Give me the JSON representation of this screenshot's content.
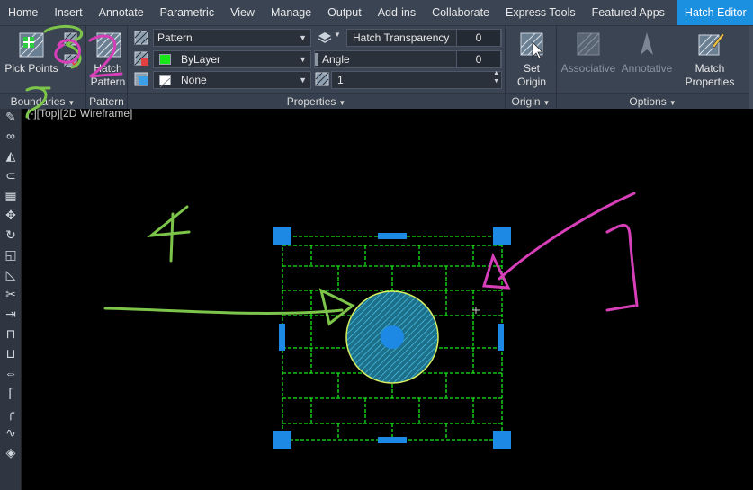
{
  "tabs": [
    "Home",
    "Insert",
    "Annotate",
    "Parametric",
    "View",
    "Manage",
    "Output",
    "Add-ins",
    "Collaborate",
    "Express Tools",
    "Featured Apps",
    "Hatch Editor"
  ],
  "active_tab": "Hatch Editor",
  "ribbon": {
    "boundaries": {
      "pick_points": "Pick Points",
      "title": "Boundaries"
    },
    "pattern": {
      "hatch_label": "Hatch",
      "pattern_label": "Pattern",
      "title": "Pattern"
    },
    "properties": {
      "hatch_type": "Pattern",
      "color": "ByLayer",
      "color_hex": "#19e619",
      "background": "None",
      "transparency_label": "Hatch Transparency",
      "transparency_value": "0",
      "angle_label": "Angle",
      "angle_value": "0",
      "scale_value": "1",
      "title": "Properties"
    },
    "origin": {
      "set_origin_line1": "Set",
      "set_origin_line2": "Origin",
      "title": "Origin"
    },
    "options": {
      "associative": "Associative",
      "annotative": "Annotative",
      "match_line1": "Match",
      "match_line2": "Properties",
      "title": "Options"
    }
  },
  "viewport_label": "[-][Top][2D Wireframe]",
  "annotations": {
    "label_1": "1",
    "label_2": "2",
    "label_3": "3",
    "label_4": "4",
    "label_5": "5"
  },
  "colors": {
    "accent": "#1b8fe0",
    "hatch_green": "#19e619",
    "grip_blue": "#1e88e5",
    "annotation_green": "#7cc44a",
    "annotation_magenta": "#d63fb8"
  }
}
